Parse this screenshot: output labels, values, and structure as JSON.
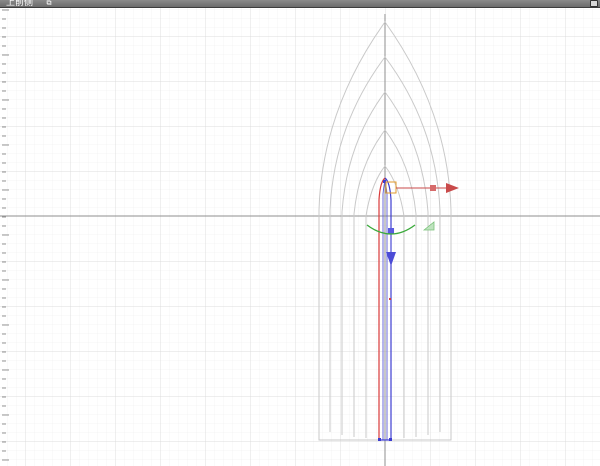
{
  "viewport": {
    "title": "上前侧",
    "menu_icon": "view-menu-icon",
    "maximize_icon": "maximize-icon"
  },
  "colors": {
    "grid_minor": "#ebebeb",
    "grid_major": "#d2d2d2",
    "axis": "#8f8f8f",
    "outline": "#c8c8c8",
    "selected_red": "#d93a3a",
    "selected_blue": "#3c3cd0",
    "gizmo_x": "#c94a4a",
    "gizmo_y": "#4c4cd6",
    "gizmo_rotate": "#3aaa3a",
    "gizmo_center": "#e29a2a"
  }
}
